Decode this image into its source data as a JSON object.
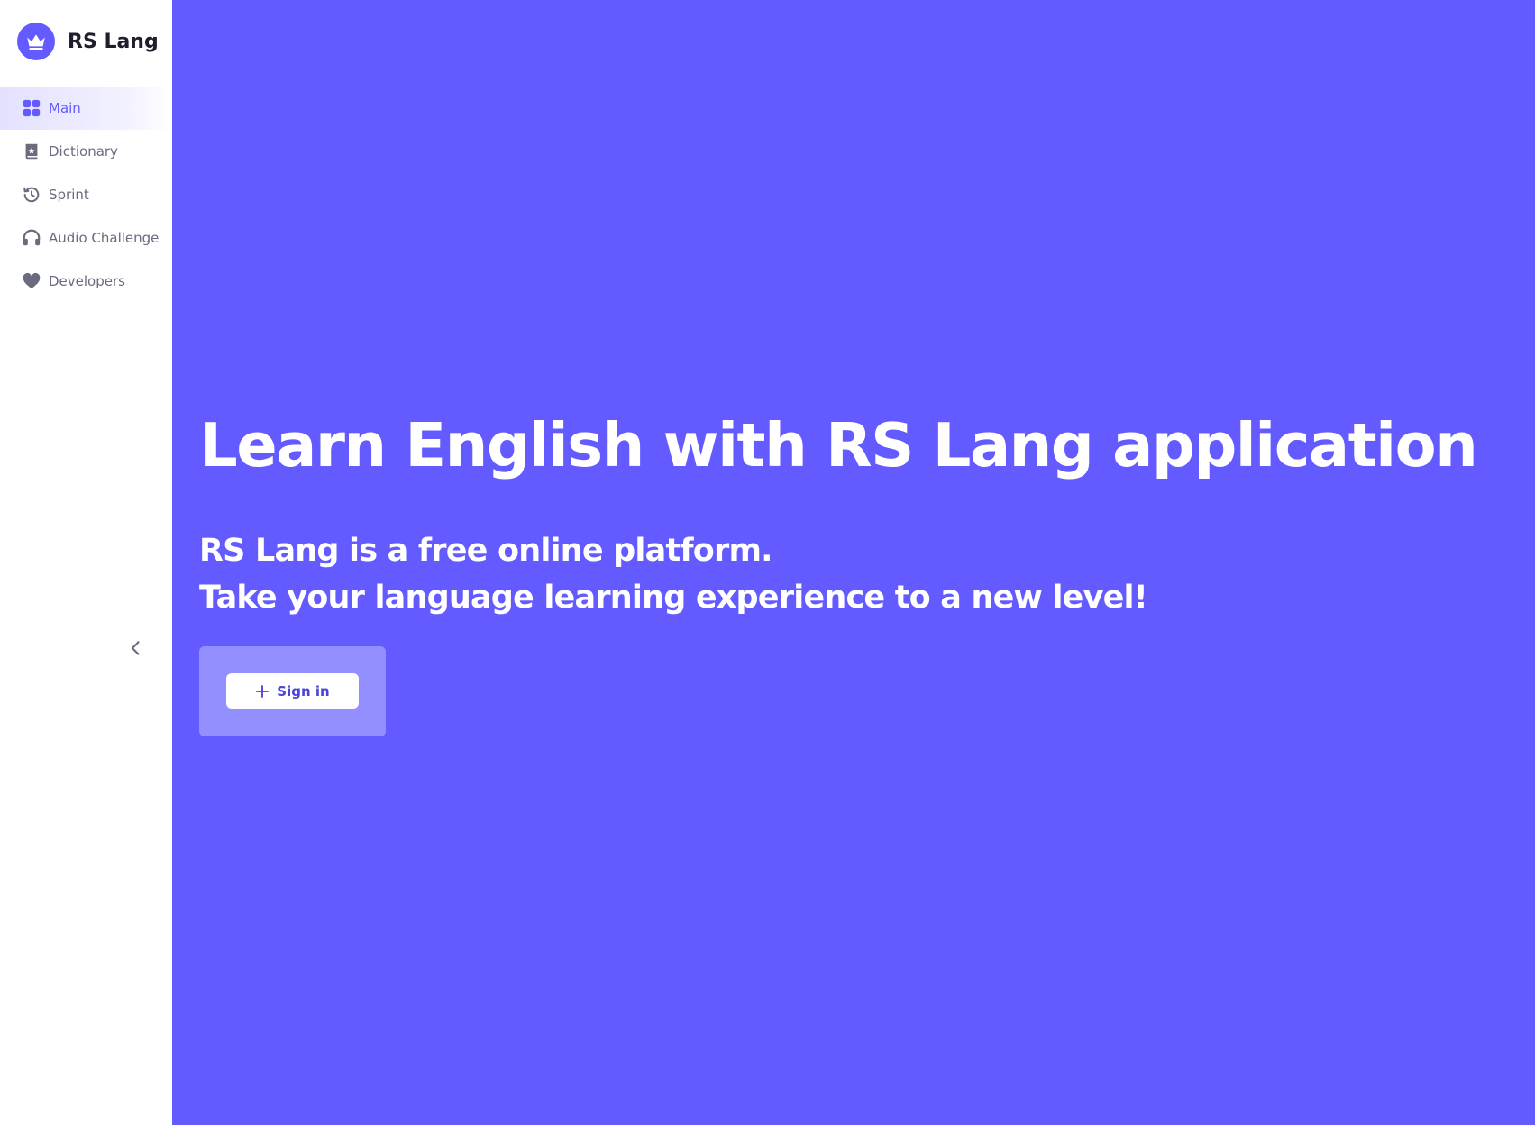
{
  "brand": {
    "name": "RS Lang",
    "logo_icon": "crown-icon"
  },
  "sidebar": {
    "items": [
      {
        "label": "Main",
        "icon": "grid-icon",
        "active": true
      },
      {
        "label": "Dictionary",
        "icon": "book-icon",
        "active": false
      },
      {
        "label": "Sprint",
        "icon": "history-icon",
        "active": false
      },
      {
        "label": "Audio Challenge",
        "icon": "headphones-icon",
        "active": false
      },
      {
        "label": "Developers",
        "icon": "heart-icon",
        "active": false
      }
    ],
    "collapse_icon": "chevron-left-icon"
  },
  "hero": {
    "title": "Learn English with RS Lang application",
    "subtitle_line1": "RS Lang is a free online platform.",
    "subtitle_line2": "Take your language learning experience to a new level!",
    "signin_label": "Sign in",
    "signin_icon": "plus-icon"
  },
  "colors": {
    "accent": "#635bff",
    "panel": "#948fff",
    "sidebar_bg": "#ffffff",
    "nav_text": "#6b6b80",
    "active_bg": "#e3e1ff"
  }
}
